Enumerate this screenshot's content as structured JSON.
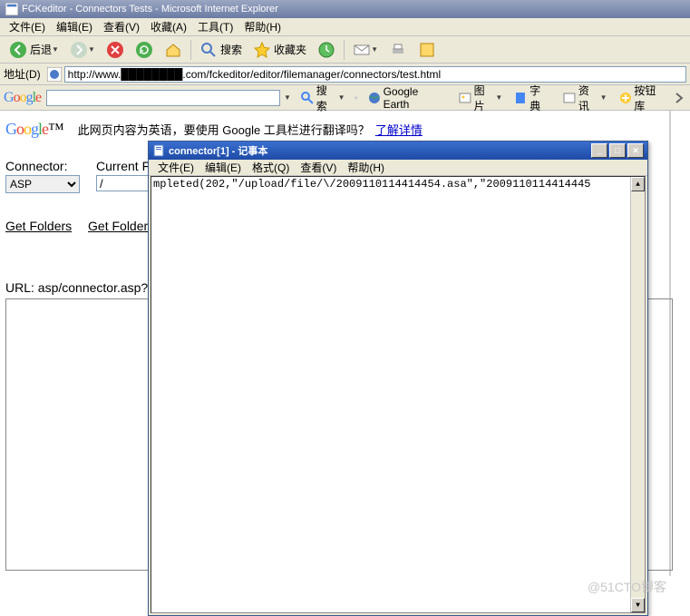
{
  "window": {
    "title": "FCKeditor - Connectors Tests - Microsoft Internet Explorer"
  },
  "menu": {
    "file": "文件(E)",
    "edit": "编辑(E)",
    "view": "查看(V)",
    "fav": "收藏(A)",
    "tools": "工具(T)",
    "help": "帮助(H)"
  },
  "toolbar": {
    "back": "后退",
    "search": "搜索",
    "favorites": "收藏夹"
  },
  "address": {
    "label": "地址(D)",
    "url": "http://www.████████.com/fckeditor/editor/filemanager/connectors/test.html"
  },
  "google_tb": {
    "search_btn": "搜索",
    "earth": "Google Earth",
    "pic": "图片",
    "dict": "字典",
    "news": "资讯",
    "btnlib": "按钮库"
  },
  "translate": {
    "text": "此网页内容为英语，要使用 Google 工具栏进行翻译吗？",
    "link": "了解详情"
  },
  "page": {
    "connector_label": "Connector:",
    "connector_value": "ASP",
    "folder_label": "Current F",
    "folder_value": "/",
    "link_get_folders": "Get Folders",
    "link_get_folders_a": "Get Folders a",
    "url_label": "URL: asp/connector.asp?C"
  },
  "notepad": {
    "title": "connector[1] - 记事本",
    "menu": {
      "file": "文件(E)",
      "edit": "编辑(E)",
      "format": "格式(Q)",
      "view": "查看(V)",
      "help": "帮助(H)"
    },
    "content": "mpleted(202,\"/upload/file/\\/2009110114414454.asa\",\"2009110114414445"
  },
  "watermark": "@51CTO博客"
}
